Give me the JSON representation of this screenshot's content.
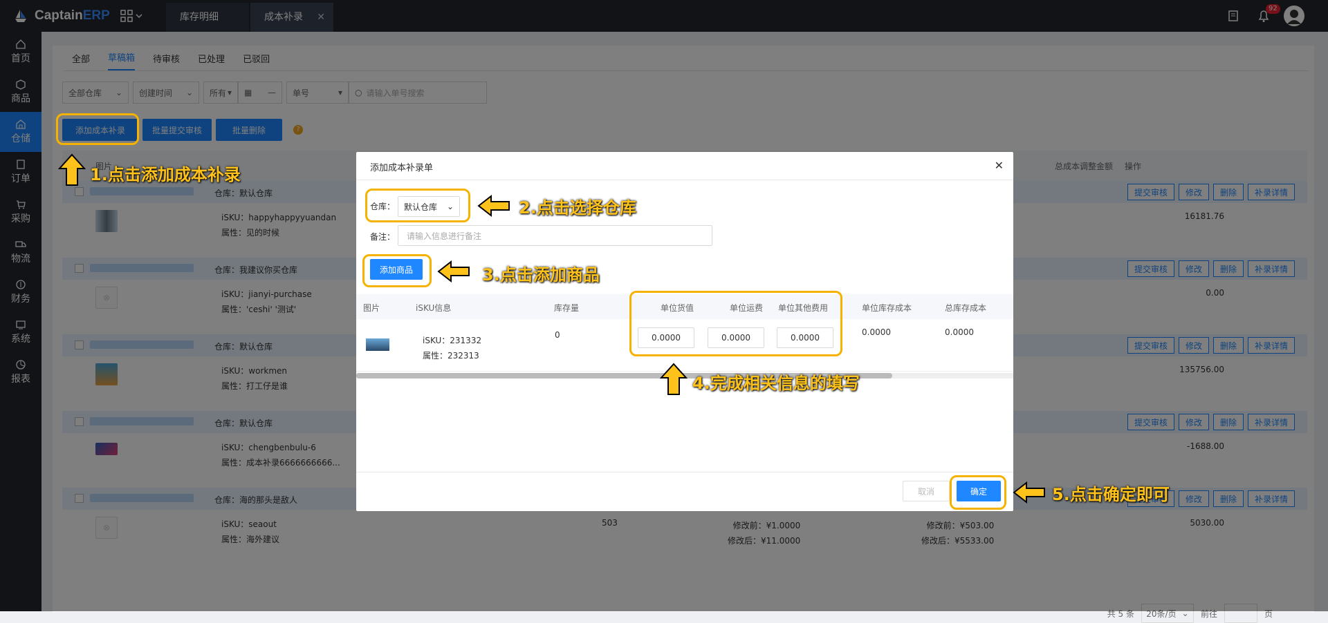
{
  "app": {
    "brand_main": "Captain",
    "brand_accent": "ERP"
  },
  "top_tabs": [
    {
      "label": "库存明细"
    },
    {
      "label": "成本补录"
    }
  ],
  "notifications": {
    "count": "92"
  },
  "sidebar": {
    "items": [
      {
        "label": "首页",
        "icon": "home-icon"
      },
      {
        "label": "商品",
        "icon": "box-icon"
      },
      {
        "label": "仓储",
        "icon": "warehouse-icon"
      },
      {
        "label": "订单",
        "icon": "order-icon"
      },
      {
        "label": "采购",
        "icon": "cart-icon"
      },
      {
        "label": "物流",
        "icon": "truck-icon"
      },
      {
        "label": "财务",
        "icon": "finance-icon"
      },
      {
        "label": "系统",
        "icon": "system-icon"
      },
      {
        "label": "报表",
        "icon": "report-icon"
      }
    ]
  },
  "status_tabs": [
    "全部",
    "草稿箱",
    "待审核",
    "已处理",
    "已驳回"
  ],
  "filters": {
    "warehouse": "全部仓库",
    "time": "创建时间",
    "all": "所有",
    "date_sep": "—",
    "order_no": "单号",
    "search_placeholder": "请输入单号搜索"
  },
  "actions": {
    "add": "添加成本补录",
    "batch_submit": "批量提交审核",
    "batch_delete": "批量删除",
    "help": "?"
  },
  "table": {
    "header_total": "总成本调整金额",
    "header_ops": "操作",
    "header_img": "图片"
  },
  "row_buttons": {
    "submit": "提交审核",
    "edit": "修改",
    "delete": "删除",
    "detail": "补录详情"
  },
  "groups": [
    {
      "warehouse": "仓库：默认仓库",
      "sku": "iSKU：happyhappyyuandan",
      "attr": "属性：见的时候",
      "amount": "16181.76"
    },
    {
      "warehouse": "仓库：我建议你买仓库",
      "sku": "iSKU：jianyi-purchase",
      "attr": "属性：'ceshi'  '测试'",
      "amount": "0.00"
    },
    {
      "warehouse": "仓库：默认仓库",
      "sku": "iSKU：workmen",
      "attr": "属性：打工仔是谁",
      "amount": "135756.00"
    },
    {
      "warehouse": "仓库：默认仓库",
      "sku": "iSKU：chengbenbulu-6",
      "attr": "属性：成本补录6666666666...",
      "amount": "-1688.00"
    },
    {
      "warehouse": "仓库：海的那头是敌人",
      "sku": "iSKU：seaout",
      "attr": "属性：海外建议",
      "amount": "5030.00",
      "qty": "503",
      "before1": "修改前：¥1.0000",
      "after1": "修改后：¥11.0000",
      "before2": "修改前：¥503.00",
      "after2": "修改后：¥5533.00"
    }
  ],
  "pager": {
    "total": "共 5 条",
    "size": "20条/页",
    "goto": "前往",
    "page": "页"
  },
  "modal": {
    "title": "添加成本补录单",
    "warehouse_label": "仓库：",
    "warehouse_value": "默认仓库",
    "remark_label": "备注：",
    "remark_placeholder": "请输入信息进行备注",
    "add_goods": "添加商品",
    "columns": [
      "图片",
      "iSKU信息",
      "库存量",
      "单位货值",
      "单位运费",
      "单位其他费用",
      "单位库存成本",
      "总库存成本"
    ],
    "row": {
      "sku": "iSKU：231332",
      "attr": "属性：232313",
      "stock": "0",
      "unit_value": "0.0000",
      "unit_freight": "0.0000",
      "unit_other": "0.0000",
      "unit_cost": "0.0000",
      "total_cost": "0.0000"
    },
    "cancel": "取消",
    "confirm": "确定"
  },
  "callouts": [
    "1.点击添加成本补录",
    "2.点击选择仓库",
    "3.点击添加商品",
    "4.完成相关信息的填写",
    "5.点击确定即可"
  ],
  "colors": {
    "accent": "#1f87ff",
    "highlight": "#f5b200",
    "callout": "#ffc21a",
    "sidebar": "#23272e"
  }
}
